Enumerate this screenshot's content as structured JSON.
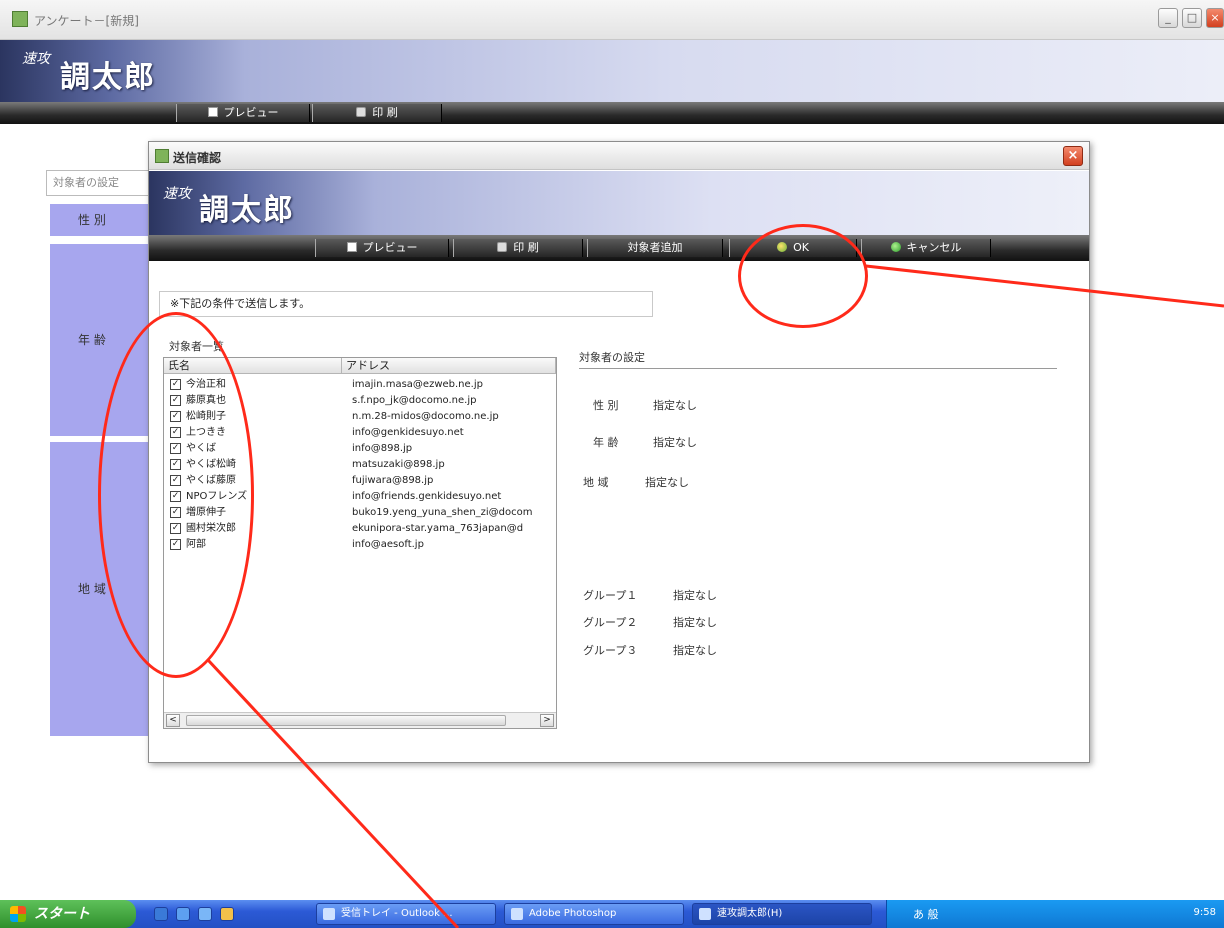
{
  "window": {
    "title": "アンケート－[新規]",
    "btn_min": "_",
    "btn_max": "□",
    "btn_close": "×"
  },
  "brand": {
    "logo_small": "速攻",
    "logo_main": "調太郎"
  },
  "toolbar": {
    "preview": "プレビュー",
    "print": "印 刷"
  },
  "background_form": {
    "search_text": "対象者の設定",
    "gender_label": "性 別",
    "age_label": "年 齢",
    "region_label": "地 域"
  },
  "dialog": {
    "title": "送信確認",
    "close": "×",
    "toolbar": {
      "preview": "プレビュー",
      "print": "印 刷",
      "add_target": "対象者追加",
      "ok": "OK",
      "cancel": "キャンセル"
    },
    "notice": "※下記の条件で送信します。",
    "list_title": "対象者一覧",
    "columns": {
      "name": "氏名",
      "address": "アドレス"
    },
    "recipients": [
      {
        "check": "✓",
        "name": "今治正和",
        "address": "imajin.masa@ezweb.ne.jp"
      },
      {
        "check": "✓",
        "name": "藤原真也",
        "address": "s.f.npo_jk@docomo.ne.jp"
      },
      {
        "check": "✓",
        "name": "松崎則子",
        "address": "n.m.28-midos@docomo.ne.jp"
      },
      {
        "check": "✓",
        "name": "上つきき",
        "address": "info@genkidesuyo.net"
      },
      {
        "check": "✓",
        "name": "やくば",
        "address": "info@898.jp"
      },
      {
        "check": "✓",
        "name": "やくば松崎",
        "address": "matsuzaki@898.jp"
      },
      {
        "check": "✓",
        "name": "やくば藤原",
        "address": "fujiwara@898.jp"
      },
      {
        "check": "✓",
        "name": "NPOフレンズ",
        "address": "info@friends.genkidesuyo.net"
      },
      {
        "check": "✓",
        "name": "増原伸子",
        "address": "buko19.yeng_yuna_shen_zi@docom"
      },
      {
        "check": "✓",
        "name": "國村栄次郎",
        "address": "ekunipora-star.yama_763japan@d"
      },
      {
        "check": "✓",
        "name": "阿部",
        "address": "info@aesoft.jp"
      }
    ],
    "scroll_left": "<",
    "scroll_right": ">",
    "settings": {
      "title": "対象者の設定",
      "gender": {
        "label": "性 別",
        "value": "指定なし"
      },
      "age": {
        "label": "年 齢",
        "value": "指定なし"
      },
      "region": {
        "label": "地 域",
        "value": "指定なし"
      },
      "group1": {
        "label": "グループ１",
        "value": "指定なし"
      },
      "group2": {
        "label": "グループ２",
        "value": "指定なし"
      },
      "group3": {
        "label": "グループ３",
        "value": "指定なし"
      }
    }
  },
  "taskbar": {
    "start": "スタート",
    "tasks": [
      "受信トレイ - Outlook ...",
      "Adobe Photoshop",
      "速攻調太郎(H)"
    ],
    "tray_text": "あ 般",
    "clock": "9:58"
  },
  "colors": {
    "annotation": "#ff2a1a",
    "form_label_bg": "#a7a6ee",
    "toolbar_dark": "#1a1a1a"
  }
}
